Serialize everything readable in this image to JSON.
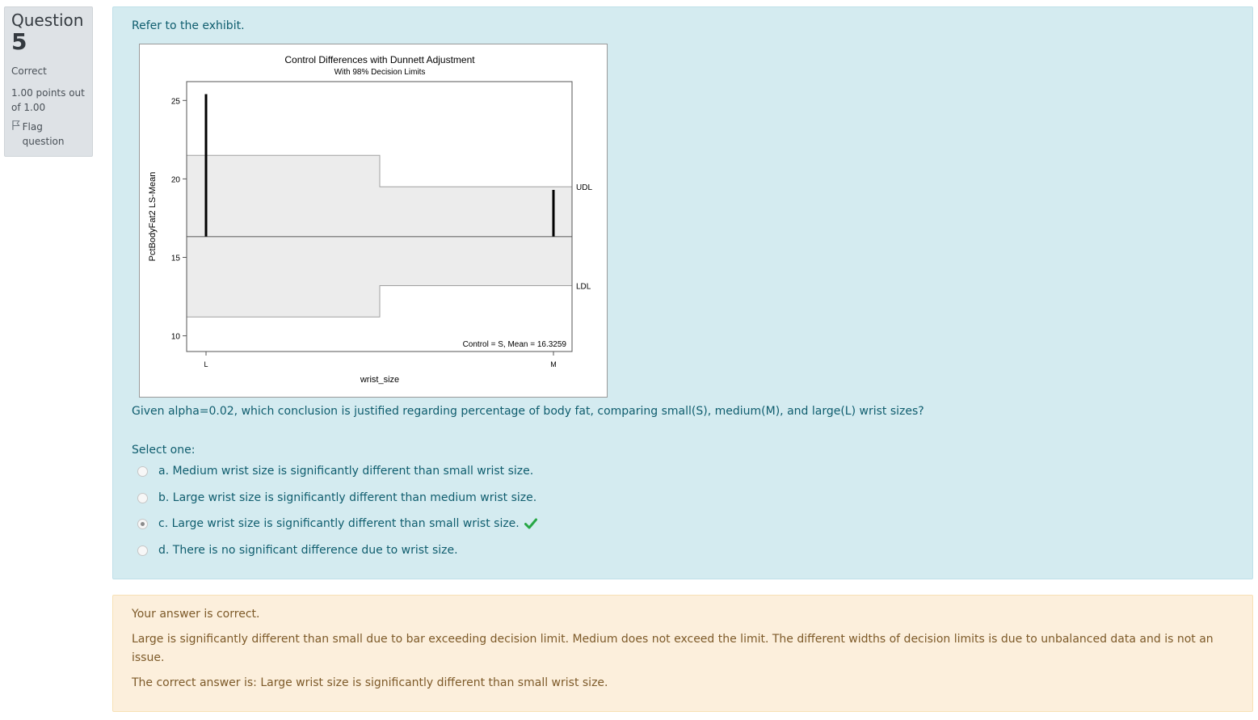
{
  "info": {
    "question_word": "Question",
    "question_number": "5",
    "state": "Correct",
    "grade": "1.00 points out of 1.00",
    "flag_label": "Flag question",
    "flag_icon": "flag-icon"
  },
  "question": {
    "intro": "Refer to the exhibit.",
    "text": "Given alpha=0.02, which conclusion is justified regarding percentage of body fat, comparing small(S), medium(M), and large(L) wrist sizes?",
    "prompt": "Select one:",
    "options": [
      {
        "label": "a. Medium wrist size is significantly different than small wrist size.",
        "checked": false
      },
      {
        "label": "b. Large wrist size is significantly different than medium wrist size.",
        "checked": false
      },
      {
        "label": "c. Large wrist size is significantly different than small wrist size.",
        "checked": true,
        "correct_icon": "check-icon"
      },
      {
        "label": "d. There is no significant difference due to wrist size.",
        "checked": false
      }
    ]
  },
  "feedback": {
    "status": "Your answer is correct.",
    "explanation": "Large is significantly different than small due to bar exceeding decision limit. Medium does not exceed the limit. The different widths of decision limits is due to unbalanced data and is not an issue.",
    "right_answer": "The correct answer is: Large wrist size is significantly different than small wrist size."
  },
  "colors": {
    "formulation_bg": "#d4ebf0",
    "feedback_bg": "#fcefdc",
    "info_bg": "#dee2e6",
    "correct_green": "#27a745"
  },
  "chart_data": {
    "type": "bar",
    "title": "Control Differences with Dunnett Adjustment",
    "subtitle": "With 98% Decision Limits",
    "xlabel": "wrist_size",
    "ylabel": "PctBodyFat2 LS-Mean",
    "categories": [
      "L",
      "M"
    ],
    "ylim": [
      9,
      26.2
    ],
    "yticks": [
      10,
      15,
      20,
      25
    ],
    "control_mean": 16.3259,
    "annotation": "Control = S, Mean = 16.3259",
    "bars": [
      {
        "category": "L",
        "value": 25.4
      },
      {
        "category": "M",
        "value": 19.3
      }
    ],
    "decision_limits": [
      {
        "category": "L",
        "udl": 21.5,
        "ldl": 11.2
      },
      {
        "category": "M",
        "udl": 19.5,
        "ldl": 13.2
      }
    ],
    "limit_labels": {
      "upper": "UDL",
      "lower": "LDL"
    },
    "grid": false,
    "legend": "none"
  }
}
